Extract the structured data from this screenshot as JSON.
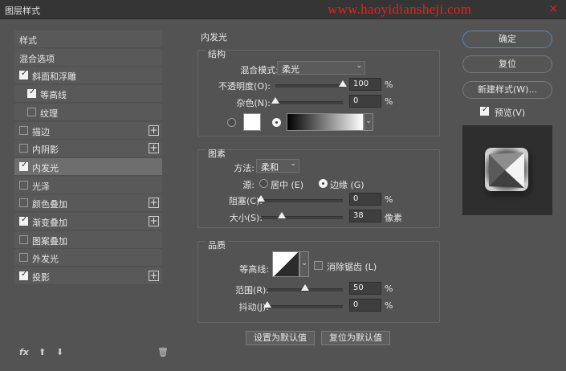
{
  "window": {
    "title": "图层样式",
    "watermark": "www.haoyidiansheji.com",
    "close": "×"
  },
  "left_panel": {
    "items": [
      {
        "label": "样式",
        "checkbox": null,
        "plus": false,
        "indent": 0,
        "selected": false
      },
      {
        "label": "混合选项",
        "checkbox": null,
        "plus": false,
        "indent": 0,
        "selected": false
      },
      {
        "label": "斜面和浮雕",
        "checkbox": true,
        "plus": false,
        "indent": 0,
        "selected": false
      },
      {
        "label": "等高线",
        "checkbox": true,
        "plus": false,
        "indent": 1,
        "selected": false
      },
      {
        "label": "纹理",
        "checkbox": false,
        "plus": false,
        "indent": 1,
        "selected": false
      },
      {
        "label": "描边",
        "checkbox": false,
        "plus": true,
        "indent": 0,
        "selected": false
      },
      {
        "label": "内阴影",
        "checkbox": false,
        "plus": true,
        "indent": 0,
        "selected": false
      },
      {
        "label": "内发光",
        "checkbox": true,
        "plus": false,
        "indent": 0,
        "selected": true
      },
      {
        "label": "光泽",
        "checkbox": false,
        "plus": false,
        "indent": 0,
        "selected": false
      },
      {
        "label": "颜色叠加",
        "checkbox": false,
        "plus": true,
        "indent": 0,
        "selected": false
      },
      {
        "label": "渐变叠加",
        "checkbox": true,
        "plus": true,
        "indent": 0,
        "selected": false
      },
      {
        "label": "图案叠加",
        "checkbox": false,
        "plus": false,
        "indent": 0,
        "selected": false
      },
      {
        "label": "外发光",
        "checkbox": false,
        "plus": false,
        "indent": 0,
        "selected": false
      },
      {
        "label": "投影",
        "checkbox": true,
        "plus": true,
        "indent": 0,
        "selected": false
      }
    ],
    "footer": {
      "fx": "fx",
      "up": "⬆",
      "down": "⬇",
      "trash": "🗑"
    }
  },
  "inner_glow": {
    "title": "内发光",
    "structure": {
      "title": "结构",
      "blend_mode_label": "混合模式:",
      "blend_mode_value": "柔光",
      "opacity_label": "不透明度(O):",
      "opacity_value": "100",
      "opacity_level": 1.0,
      "noise_label": "杂色(N):",
      "noise_value": "0",
      "noise_level": 0.0,
      "percent": "%"
    },
    "elements": {
      "title": "图素",
      "method_label": "方法:",
      "method_value": "柔和",
      "source_label": "源:",
      "source_center": "居中 (E)",
      "source_edge": "边缘 (G)",
      "choke_label": "阻塞(C):",
      "choke_value": "0",
      "choke_level": 0.0,
      "size_label": "大小(S):",
      "size_value": "38",
      "size_level": 0.25,
      "size_unit": "像素",
      "percent": "%"
    },
    "quality": {
      "title": "品质",
      "contour_label": "等高线:",
      "antialias_label": "消除锯齿 (L)",
      "range_label": "范围(R):",
      "range_value": "50",
      "range_level": 0.5,
      "jitter_label": "抖动(J):",
      "jitter_value": "0",
      "jitter_level": 0.0,
      "percent": "%"
    },
    "buttons": {
      "set_default": "设置为默认值",
      "reset_default": "复位为默认值"
    }
  },
  "right_panel": {
    "ok": "确定",
    "reset": "复位",
    "new_style": "新建样式(W)...",
    "preview_label": "预览(V)",
    "preview_checked": true
  },
  "colors": {
    "accent": "#5a87b8",
    "watermark": "#e8231f"
  }
}
